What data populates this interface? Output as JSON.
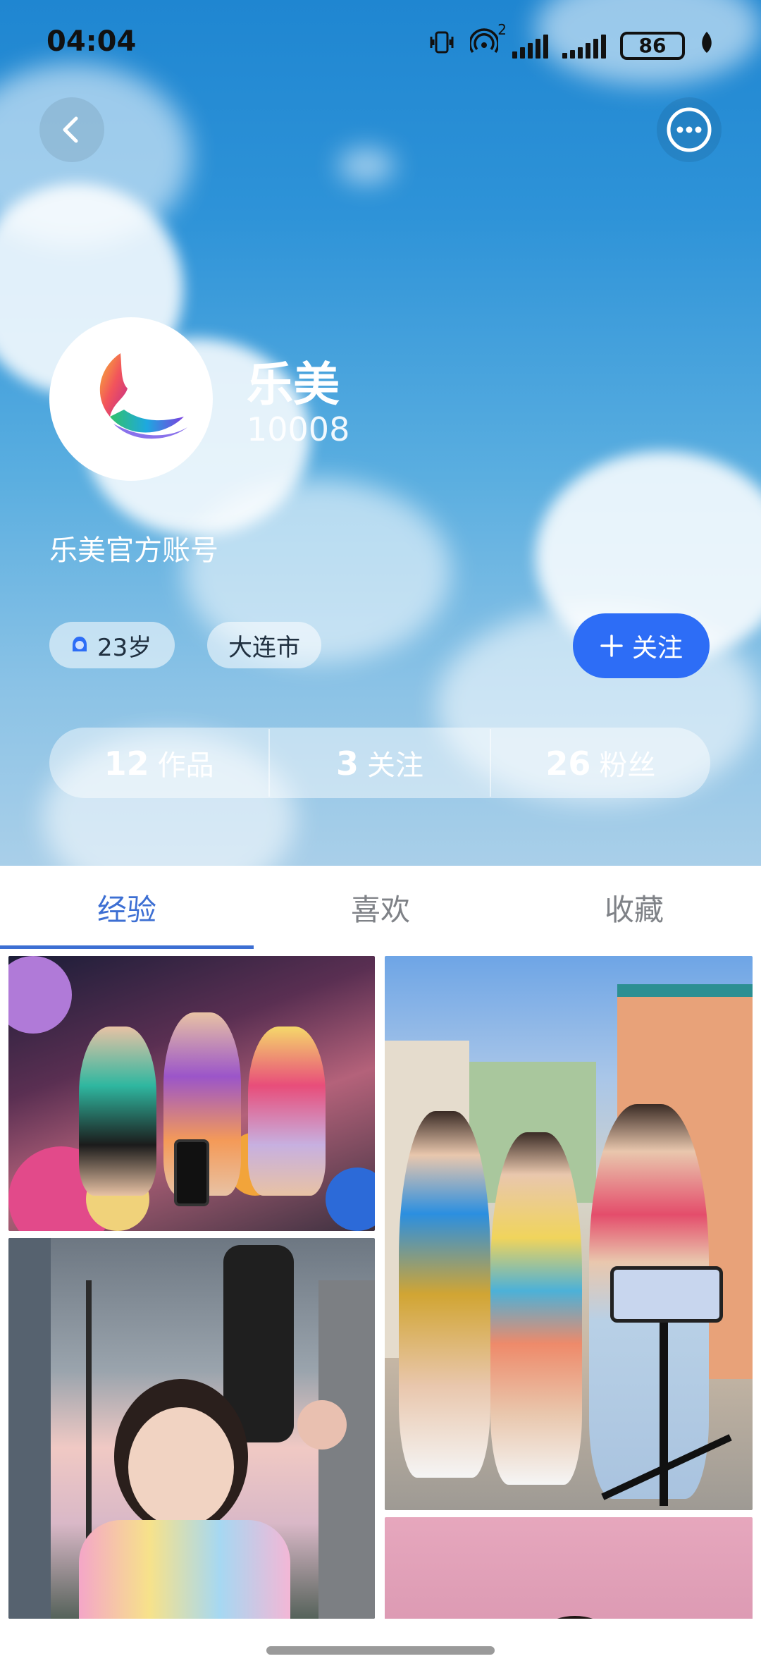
{
  "status_bar": {
    "time": "04:04",
    "battery": "86",
    "network_superscript": "2"
  },
  "header": {
    "back_icon": "chevron-left-icon",
    "more_icon": "more-horizontal-icon"
  },
  "profile": {
    "name": "乐美",
    "id": "10008",
    "bio": "乐美官方账号",
    "tags": {
      "age": "23岁",
      "city": "大连市"
    },
    "follow_label": "关注",
    "stats": [
      {
        "num": "12",
        "label": "作品"
      },
      {
        "num": "3",
        "label": "关注"
      },
      {
        "num": "26",
        "label": "粉丝"
      }
    ]
  },
  "tabs": [
    {
      "label": "经验",
      "active": true
    },
    {
      "label": "喜欢",
      "active": false
    },
    {
      "label": "收藏",
      "active": false
    }
  ],
  "colors": {
    "accent": "#2d6df6",
    "tab_active": "#3d6fd3",
    "tab_inactive": "#7f8287"
  }
}
